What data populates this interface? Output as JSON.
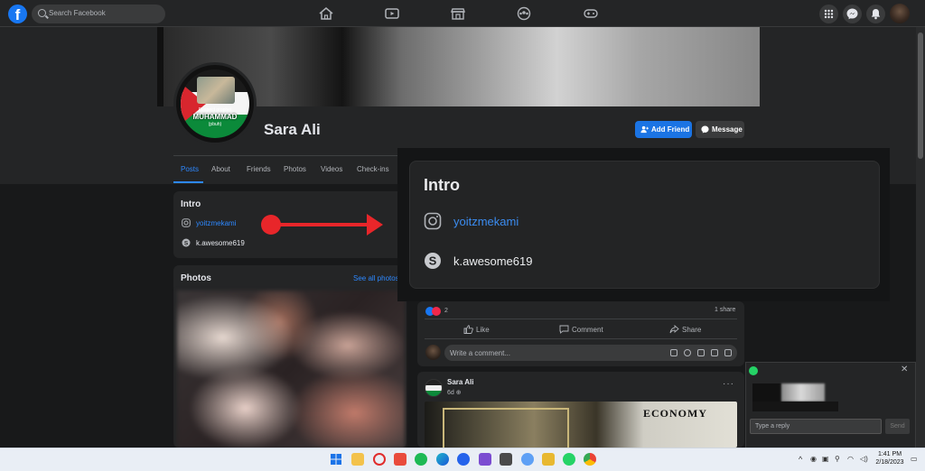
{
  "topbar": {
    "search_placeholder": "Search Facebook",
    "nav_icons": [
      "home-icon",
      "watch-icon",
      "marketplace-icon",
      "groups-icon",
      "gaming-icon"
    ],
    "right_icons": [
      "menu-grid-icon",
      "messenger-icon",
      "notifications-icon",
      "profile-avatar"
    ]
  },
  "profile": {
    "name": "Sara Ali",
    "picture_text": {
      "line1": "Respect prophet",
      "line2": "MUHAMMAD",
      "line3": "(pbuh)"
    },
    "add_friend_label": "Add Friend",
    "message_label": "Message",
    "tabs": [
      "Posts",
      "About",
      "Friends",
      "Photos",
      "Videos",
      "Check-ins"
    ],
    "active_tab": "Posts"
  },
  "intro": {
    "title": "Intro",
    "instagram": "yoitzmekami",
    "skype": "k.awesome619"
  },
  "photos": {
    "title": "Photos",
    "see_all": "See all photos"
  },
  "zoom": {
    "title": "Intro",
    "instagram": "yoitzmekami",
    "skype": "k.awesome619"
  },
  "post1": {
    "reaction_count": "2",
    "share_count": "1 share",
    "like_label": "Like",
    "comment_label": "Comment",
    "share_label": "Share",
    "comment_placeholder": "Write a comment..."
  },
  "post2": {
    "author": "Sara Ali",
    "time": "6d",
    "image_heading": "ECONOMY"
  },
  "chat": {
    "reply_placeholder": "Type a reply",
    "send_label": "Send"
  },
  "taskbar": {
    "time": "1:41 PM",
    "date": "2/18/2023",
    "apps": [
      "windows-start",
      "file-explorer",
      "opera",
      "game-app",
      "spotify",
      "edge",
      "tasks-app",
      "teams-app",
      "camera-app",
      "photos-app",
      "folder",
      "whatsapp",
      "chrome"
    ]
  },
  "colors": {
    "accent": "#2d88ff",
    "button_blue": "#1b74e4",
    "arrow_red": "#e8262a",
    "background": "#18191a",
    "card": "#242526"
  }
}
